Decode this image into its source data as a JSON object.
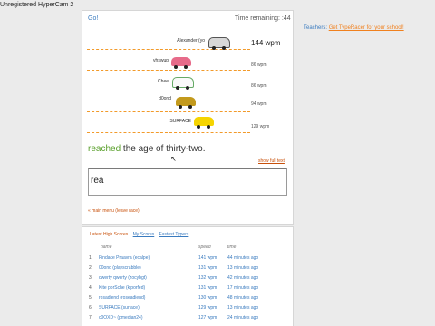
{
  "hypercam": "Unregistered HyperCam 2",
  "race": {
    "go": "Go!",
    "time_label": "Time remaining: :44",
    "racers": [
      {
        "name": "Alexander (yo",
        "wpm": "144 wpm",
        "color": "#d8d8d8"
      },
      {
        "name": "vhswup",
        "wpm": "86 wpm",
        "color": "#e76b8a"
      },
      {
        "name": "Chee",
        "wpm": "86 wpm",
        "color": "#ffffff"
      },
      {
        "name": "d0ond",
        "wpm": "94 wpm",
        "color": "#c39a1d"
      },
      {
        "name": "SURFACE",
        "wpm": "129 wpm",
        "color": "#f5d400"
      }
    ],
    "typed_done": "reached",
    "typed_rest": " the age of thirty-two.",
    "show_full_text": "show full text",
    "input_value": "rea",
    "main_menu_link": "« main menu (leave race)"
  },
  "teachers": {
    "label": "Teachers:",
    "link": "Get TypeRacer for your school!"
  },
  "scores": {
    "tabs": [
      "Latest High Scores",
      "My Scores",
      "Fastest Typers"
    ],
    "headers": {
      "name": "name",
      "speed": "speed",
      "time": "time"
    },
    "rows": [
      {
        "idx": "1",
        "name": "Findace Praavra (ecalpe)",
        "speed": "141 wpm",
        "time": "44 minutes ago"
      },
      {
        "idx": "2",
        "name": "00ond (playscrabble)",
        "speed": "131 wpm",
        "time": "13 minutes ago"
      },
      {
        "idx": "3",
        "name": "qwerty qwerty (zocybgt)",
        "speed": "132 wpm",
        "time": "42 minutes ago"
      },
      {
        "idx": "4",
        "name": "Kite porSche (kiporfed)",
        "speed": "131 wpm",
        "time": "17 minutes ago"
      },
      {
        "idx": "5",
        "name": "rosadiend (roseadiend)",
        "speed": "130 wpm",
        "time": "48 minutes ago"
      },
      {
        "idx": "6",
        "name": "SURFACE (surface)",
        "speed": "129 wpm",
        "time": "13 minutes ago"
      },
      {
        "idx": "7",
        "name": "c0OXD~ (pmedian24)",
        "speed": "127 wpm",
        "time": "24 minutes ago"
      }
    ]
  }
}
